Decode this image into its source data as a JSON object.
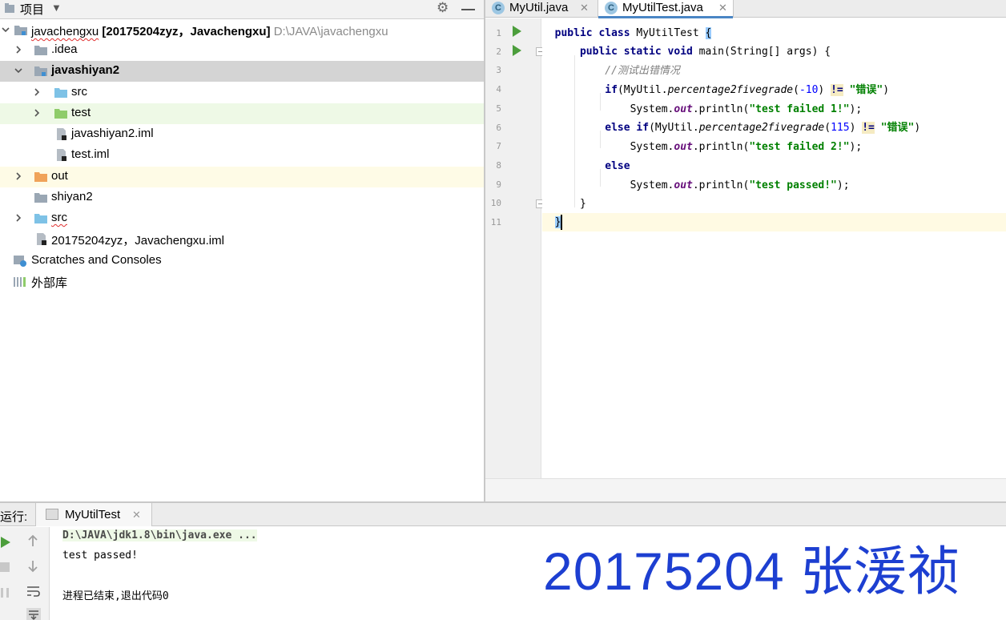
{
  "project_panel": {
    "title": "项目",
    "tree": [
      {
        "label": "javachengxu",
        "suffix": "[20175204zyz，Javachengxu]",
        "path": "D:\\JAVA\\javachengxu"
      },
      {
        "label": ".idea"
      },
      {
        "label": "javashiyan2"
      },
      {
        "label": "src"
      },
      {
        "label": "test"
      },
      {
        "label": "javashiyan2.iml"
      },
      {
        "label": "test.iml"
      },
      {
        "label": "out"
      },
      {
        "label": "shiyan2"
      },
      {
        "label": "src"
      },
      {
        "label": "20175204zyz，Javachengxu.iml"
      },
      {
        "label": "Scratches and Consoles"
      },
      {
        "label": "外部库"
      }
    ]
  },
  "editor": {
    "tabs": [
      {
        "label": "MyUtil.java",
        "icon": "C"
      },
      {
        "label": "MyUtilTest.java",
        "icon": "C"
      }
    ],
    "line_numbers": [
      "1",
      "2",
      "3",
      "4",
      "5",
      "6",
      "7",
      "8",
      "9",
      "10",
      "11"
    ],
    "code": {
      "l1_kw": "public class",
      "l1_name": " MyUtilTest ",
      "l1_brace": "{",
      "l2_kw": "public static void",
      "l2_rest": " main(String[] args) {",
      "l3_comment": "//测试出错情况",
      "if_kw": "if",
      "else_if_kw": "else if",
      "else_kw": "else",
      "call_pre": "(MyUtil.",
      "method": "percentage2fivegrade",
      "open_paren": "(",
      "arg1": "-10",
      "arg2": "115",
      "close_paren": ") ",
      "neq": "!=",
      "cmp_str": "\"错误\"",
      "end_paren": ")",
      "sys": "System.",
      "out": "out",
      "println": ".println(",
      "str1": "\"test failed 1!\"",
      "str2": "\"test failed 2!\"",
      "str3": "\"test passed!\"",
      "stmt_end": ");",
      "close_method": "}",
      "close_class": "}"
    }
  },
  "run_panel": {
    "label": "运行:",
    "tab_label": "MyUtilTest",
    "console": {
      "cmd": "D:\\JAVA\\jdk1.8\\bin\\java.exe ...",
      "output": "test passed!",
      "exit": "进程已结束,退出代码0"
    },
    "watermark": "20175204  张湲祯"
  },
  "colors": {
    "keyword": "#000080",
    "string": "#008000",
    "number": "#0000ff",
    "watermark": "#1d3fd1",
    "run_green": "#4c9e3c",
    "folder_blue": "#7ec2e6",
    "folder_green": "#8fcc6a",
    "folder_orange": "#f0a35a"
  }
}
